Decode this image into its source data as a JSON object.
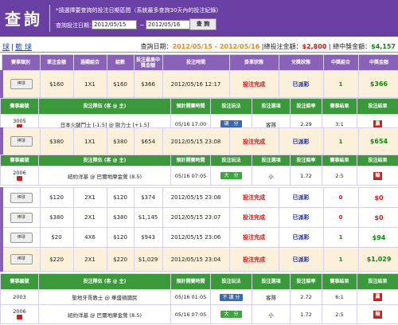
{
  "header": {
    "title": "查詢",
    "notice": "*請選擇要查詢的投注日期區間（系統最多查詢30天內的投注紀錄）",
    "date_label": "查詢投注日期：",
    "date_from": "2012/05/15",
    "date_to": "2012/05/16",
    "tilde": "~",
    "query_button": "查 詢"
  },
  "summary": {
    "tab1": "球",
    "tab_sep": "|",
    "tab2": "籃 球",
    "range_label": "查詢日期：",
    "range_value": "2012/05/15 - 2012/05/16",
    "total_bet_label": "|總投注金額：",
    "total_bet_value": "$2,800",
    "total_win_label": "| 總中獎金額：",
    "total_win_value": "$4,157"
  },
  "headers": {
    "main": [
      "賽事類別",
      "單注金額",
      "過關組合",
      "組數",
      "投注最高中獎金額",
      "投注時間",
      "掛單狀態",
      "兌獎狀態",
      "中獎組合",
      "中獎金額"
    ],
    "detail": [
      "賽事編號",
      "投注隊伍 (客 @ 主)",
      "預計開賽時間",
      "投注玩法",
      "投注選項",
      "投注賠率",
      "賽事結果",
      "投注結果"
    ]
  },
  "bets": [
    {
      "ret": "棒球",
      "unit": "$160",
      "combo": "1X1",
      "groups": "$160",
      "max": "$366",
      "time": "2012/05/16 12:17",
      "status": "投注完成",
      "prize": "已派彩",
      "wins": "1",
      "win_amt": "$366"
    },
    {
      "ret": "棒球",
      "unit": "$380",
      "combo": "1X1",
      "groups": "$380",
      "max": "$654",
      "time": "2012/05/15 23:08",
      "status": "投注完成",
      "prize": "已派彩",
      "wins": "1",
      "win_amt": "$654"
    },
    {
      "ret": "棒球",
      "unit": "$120",
      "combo": "2X1",
      "groups": "$120",
      "max": "$374",
      "time": "2012/05/15 23:08",
      "status": "投注完成",
      "prize": "已派彩",
      "wins": "0",
      "win_amt": "$0"
    },
    {
      "ret": "棒球",
      "unit": "$380",
      "combo": "2X1",
      "groups": "$380",
      "max": "$1,145",
      "time": "2012/05/15 23:07",
      "status": "投注完成",
      "prize": "已派彩",
      "wins": "0",
      "win_amt": "$0"
    },
    {
      "ret": "棒球",
      "unit": "$20",
      "combo": "4X6",
      "groups": "$120",
      "max": "$943",
      "time": "2012/05/15 23:06",
      "status": "投注完成",
      "prize": "已派彩",
      "wins": "1",
      "win_amt": "$94"
    },
    {
      "ret": "棒球",
      "unit": "$220",
      "combo": "2X1",
      "groups": "$220",
      "max": "$1,029",
      "time": "2012/05/15 23:04",
      "status": "投注完成",
      "prize": "已派彩",
      "wins": "1",
      "win_amt": "$1,029"
    }
  ],
  "details": [
    {
      "id": "3005",
      "teams": "日本火腿鬥士 [-1.5] @ 歐力士 [+1.5]",
      "start": "05/16 17:00",
      "play": "讓　分",
      "play_color": "#3a6ab4",
      "option": "客隊",
      "odds": "2.29",
      "result": "3:1",
      "outcome": "贏"
    },
    {
      "id": "2006",
      "teams": "紐約洋基 @ 巴爾地摩金鶯 (8.5)",
      "start": "05/16 07:05",
      "play": "大　分",
      "play_color": "#3fa63f",
      "option": "小",
      "odds": "1.72",
      "result": "2:5",
      "outcome": "輸"
    },
    {
      "id": "2003",
      "teams": "聖地牙哥教士 @ 華盛頓國民",
      "start": "05/16 01:05",
      "play": "不 讓 分",
      "play_color": "#3a6ab4",
      "option": "客隊",
      "odds": "2.72",
      "result": "6:1",
      "outcome": "贏"
    },
    {
      "id": "2006",
      "teams": "紐約洋基 @ 巴爾地摩金鶯 (8.5)",
      "start": "05/16 07:05",
      "play": "大　分",
      "play_color": "#3fa63f",
      "option": "小",
      "odds": "1.72",
      "result": "2:5",
      "outcome": "輸"
    }
  ]
}
